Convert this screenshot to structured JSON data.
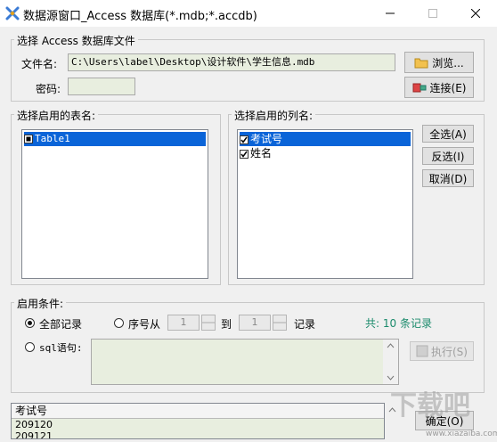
{
  "window": {
    "title": "数据源窗口_Access 数据库(*.mdb;*.accdb)"
  },
  "file_group": {
    "title": "选择 Access 数据库文件",
    "file_label": "文件名:",
    "file_value": "C:\\Users\\label\\Desktop\\设计软件\\学生信息.mdb",
    "password_label": "密码:",
    "password_value": "",
    "browse_label": "浏览...",
    "connect_label": "连接(E)"
  },
  "tables_group": {
    "title": "选择启用的表名:",
    "items": [
      {
        "label": "Table1",
        "checked": true,
        "selected": true
      }
    ]
  },
  "columns_group": {
    "title": "选择启用的列名:",
    "items": [
      {
        "label": "考试号",
        "checked": true,
        "selected": true
      },
      {
        "label": "姓名",
        "checked": true,
        "selected": false
      }
    ],
    "select_all": "全选(A)",
    "invert": "反选(I)",
    "cancel": "取消(D)"
  },
  "condition_group": {
    "title": "启用条件:",
    "all_records": "全部记录",
    "seq_from": "序号从",
    "from_value": "1",
    "to_label": "到",
    "to_value": "1",
    "records_label": "记录",
    "total_text": "共: 10 条记录",
    "sql_label": "sql语句:",
    "sql_value": "",
    "execute_label": "执行(S)"
  },
  "preview": {
    "header": "考试号",
    "rows": [
      "209120",
      "209121"
    ]
  },
  "ok_label": "确定(O)",
  "watermark": {
    "main": "下载吧",
    "url": "www.xiazaiba.com"
  }
}
